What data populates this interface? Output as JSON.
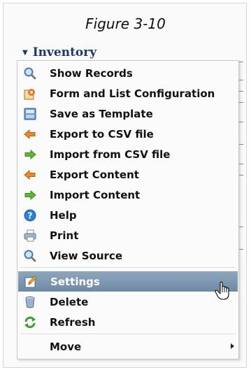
{
  "caption": "Figure 3-10",
  "tree_header": {
    "label": "Inventory",
    "icon": "triangle-down-icon"
  },
  "menu": {
    "items": [
      {
        "label": "Show Records",
        "icon": "magnifier-icon"
      },
      {
        "label": "Form and List Configuration",
        "icon": "form-config-icon"
      },
      {
        "label": "Save as Template",
        "icon": "template-icon"
      },
      {
        "label": "Export to CSV file",
        "icon": "arrow-left-orange-icon"
      },
      {
        "label": "Import from CSV file",
        "icon": "arrow-right-green-icon"
      },
      {
        "label": "Export Content",
        "icon": "arrow-left-orange-icon"
      },
      {
        "label": "Import Content",
        "icon": "arrow-right-green-icon"
      },
      {
        "label": "Help",
        "icon": "help-icon"
      },
      {
        "label": "Print",
        "icon": "printer-icon"
      },
      {
        "label": "View Source",
        "icon": "magnifier-icon"
      },
      {
        "label": "Settings",
        "icon": "pencil-edit-icon",
        "highlighted": true
      },
      {
        "label": "Delete",
        "icon": "trash-can-icon"
      },
      {
        "label": "Refresh",
        "icon": "refresh-icon"
      },
      {
        "label": "Move",
        "icon": "",
        "has_submenu": true
      }
    ]
  },
  "colors": {
    "highlight": "#7f98b1",
    "header_text": "#1f3a66"
  },
  "cursor": "hand-pointer-icon"
}
